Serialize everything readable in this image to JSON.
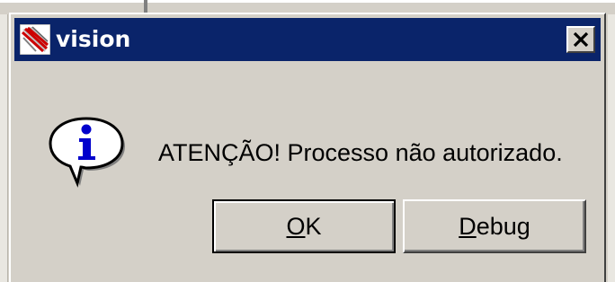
{
  "window": {
    "title": "vision",
    "title_bar_color": "#0a246a",
    "app_icon": "vision-app-icon",
    "close_icon": "close-x-icon"
  },
  "dialog": {
    "message": "ATENÇÃO! Processo não autorizado.",
    "icon": "information-balloon-icon",
    "icon_color": "#0000cc"
  },
  "buttons": {
    "ok_mnemonic": "O",
    "ok_rest": "K",
    "debug_mnemonic": "D",
    "debug_rest": "ebug"
  }
}
